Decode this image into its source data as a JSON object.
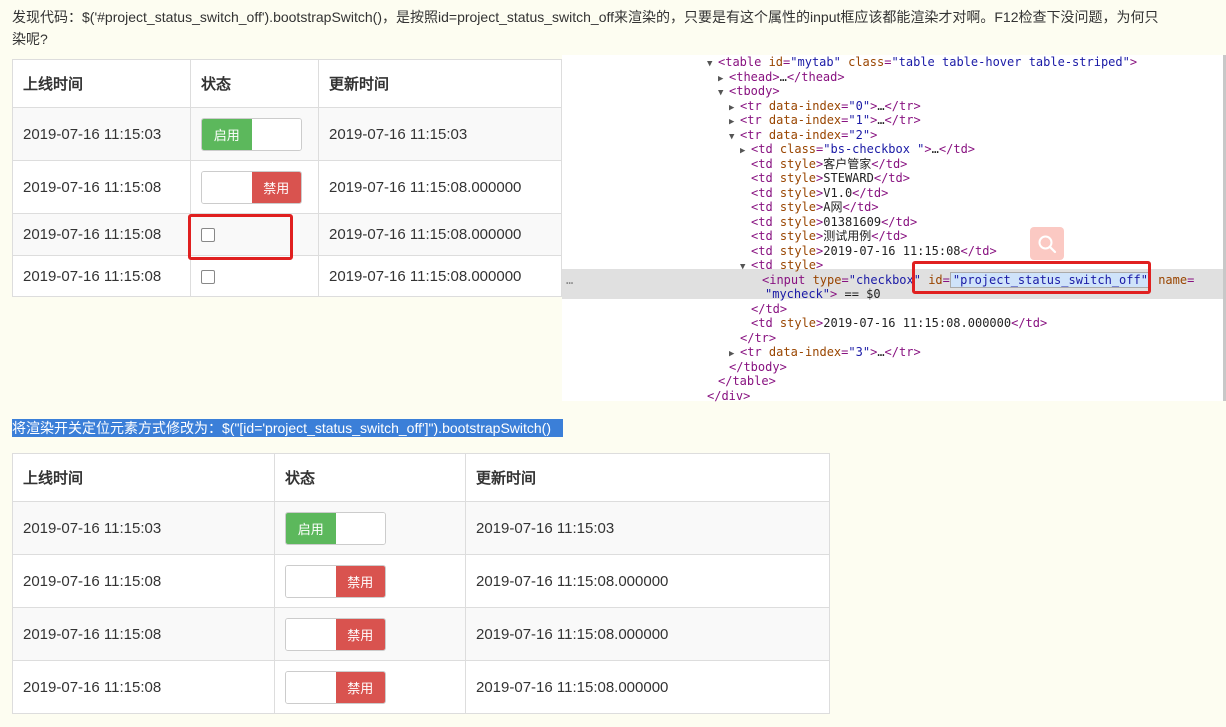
{
  "intro": {
    "line1": "发现代码：$('#project_status_switch_off').bootstrapSwitch()，是按照id=project_status_switch_off来渲染的，只要是有这个属性的input框应该都能渲染才对啊。F12检查下没问题，为何只",
    "line2": "染呢?"
  },
  "table1": {
    "headers": [
      "上线时间",
      "状态",
      "更新时间"
    ],
    "rows": [
      {
        "online": "2019-07-16 11:15:03",
        "state": "switch-on",
        "on_label": "启用",
        "updated": "2019-07-16 11:15:03"
      },
      {
        "online": "2019-07-16 11:15:08",
        "state": "switch-off",
        "off_label": "禁用",
        "updated": "2019-07-16 11:15:08.000000"
      },
      {
        "online": "2019-07-16 11:15:08",
        "state": "checkbox",
        "updated": "2019-07-16 11:15:08.000000"
      },
      {
        "online": "2019-07-16 11:15:08",
        "state": "checkbox",
        "updated": "2019-07-16 11:15:08.000000"
      }
    ]
  },
  "devtools": {
    "lines": [
      {
        "t": "▼",
        "indent": 0,
        "parts": [
          [
            "tag",
            "<table "
          ],
          [
            "attr",
            "id"
          ],
          [
            "tag",
            "="
          ],
          [
            "val",
            "\"mytab\""
          ],
          [
            "tag",
            " "
          ],
          [
            "attr",
            "class"
          ],
          [
            "tag",
            "="
          ],
          [
            "val",
            "\"table table-hover table-striped\""
          ],
          [
            "tag",
            ">"
          ]
        ]
      },
      {
        "t": "▶",
        "indent": 1,
        "parts": [
          [
            "tag",
            "<thead>"
          ],
          [
            "txt",
            "…"
          ],
          [
            "tag",
            "</thead>"
          ]
        ]
      },
      {
        "t": "▼",
        "indent": 1,
        "parts": [
          [
            "tag",
            "<tbody>"
          ]
        ]
      },
      {
        "t": "▶",
        "indent": 2,
        "parts": [
          [
            "tag",
            "<tr "
          ],
          [
            "attr",
            "data-index"
          ],
          [
            "tag",
            "="
          ],
          [
            "val",
            "\"0\""
          ],
          [
            "tag",
            ">"
          ],
          [
            "txt",
            "…"
          ],
          [
            "tag",
            "</tr>"
          ]
        ]
      },
      {
        "t": "▶",
        "indent": 2,
        "parts": [
          [
            "tag",
            "<tr "
          ],
          [
            "attr",
            "data-index"
          ],
          [
            "tag",
            "="
          ],
          [
            "val",
            "\"1\""
          ],
          [
            "tag",
            ">"
          ],
          [
            "txt",
            "…"
          ],
          [
            "tag",
            "</tr>"
          ]
        ]
      },
      {
        "t": "▼",
        "indent": 2,
        "parts": [
          [
            "tag",
            "<tr "
          ],
          [
            "attr",
            "data-index"
          ],
          [
            "tag",
            "="
          ],
          [
            "val",
            "\"2\""
          ],
          [
            "tag",
            ">"
          ]
        ]
      },
      {
        "t": "▶",
        "indent": 3,
        "parts": [
          [
            "tag",
            "<td "
          ],
          [
            "attr",
            "class"
          ],
          [
            "tag",
            "="
          ],
          [
            "val",
            "\"bs-checkbox \""
          ],
          [
            "tag",
            ">"
          ],
          [
            "txt",
            "…"
          ],
          [
            "tag",
            "</td>"
          ]
        ]
      },
      {
        "t": "",
        "indent": 3,
        "parts": [
          [
            "tag",
            "<td "
          ],
          [
            "attr",
            "style"
          ],
          [
            "tag",
            ">"
          ],
          [
            "txt",
            "客户管家"
          ],
          [
            "tag",
            "</td>"
          ]
        ]
      },
      {
        "t": "",
        "indent": 3,
        "parts": [
          [
            "tag",
            "<td "
          ],
          [
            "attr",
            "style"
          ],
          [
            "tag",
            ">"
          ],
          [
            "txt",
            "STEWARD"
          ],
          [
            "tag",
            "</td>"
          ]
        ]
      },
      {
        "t": "",
        "indent": 3,
        "parts": [
          [
            "tag",
            "<td "
          ],
          [
            "attr",
            "style"
          ],
          [
            "tag",
            ">"
          ],
          [
            "txt",
            "V1.0"
          ],
          [
            "tag",
            "</td>"
          ]
        ]
      },
      {
        "t": "",
        "indent": 3,
        "parts": [
          [
            "tag",
            "<td "
          ],
          [
            "attr",
            "style"
          ],
          [
            "tag",
            ">"
          ],
          [
            "txt",
            "A网"
          ],
          [
            "tag",
            "</td>"
          ]
        ]
      },
      {
        "t": "",
        "indent": 3,
        "parts": [
          [
            "tag",
            "<td "
          ],
          [
            "attr",
            "style"
          ],
          [
            "tag",
            ">"
          ],
          [
            "txt",
            "01381609"
          ],
          [
            "tag",
            "</td>"
          ]
        ]
      },
      {
        "t": "",
        "indent": 3,
        "parts": [
          [
            "tag",
            "<td "
          ],
          [
            "attr",
            "style"
          ],
          [
            "tag",
            ">"
          ],
          [
            "txt",
            "测试用例"
          ],
          [
            "tag",
            "</td>"
          ]
        ]
      },
      {
        "t": "",
        "indent": 3,
        "parts": [
          [
            "tag",
            "<td "
          ],
          [
            "attr",
            "style"
          ],
          [
            "tag",
            ">"
          ],
          [
            "txt",
            "2019-07-16 11:15:08"
          ],
          [
            "tag",
            "</td>"
          ]
        ]
      },
      {
        "t": "▼",
        "indent": 3,
        "parts": [
          [
            "tag",
            "<td "
          ],
          [
            "attr",
            "style"
          ],
          [
            "tag",
            ">"
          ]
        ]
      },
      {
        "t": "",
        "indent": 4,
        "parts": [
          [
            "tag",
            "<input "
          ],
          [
            "attr",
            "type"
          ],
          [
            "tag",
            "="
          ],
          [
            "val",
            "\"checkbox\""
          ],
          [
            "tag",
            " "
          ],
          [
            "sel",
            "id=\"project_status_switch_off\""
          ],
          [
            "tag",
            " "
          ],
          [
            "attr",
            "name"
          ],
          [
            "tag",
            "="
          ]
        ]
      },
      {
        "t": "",
        "indent": 4,
        "parts": [
          [
            "val",
            "\"mycheck\""
          ],
          [
            "tag",
            "> "
          ],
          [
            "txt",
            "== $0"
          ]
        ]
      },
      {
        "t": "",
        "indent": 3,
        "parts": [
          [
            "tag",
            "</td>"
          ]
        ]
      },
      {
        "t": "",
        "indent": 3,
        "parts": [
          [
            "tag",
            "<td "
          ],
          [
            "attr",
            "style"
          ],
          [
            "tag",
            ">"
          ],
          [
            "txt",
            "2019-07-16 11:15:08.000000"
          ],
          [
            "tag",
            "</td>"
          ]
        ]
      },
      {
        "t": "",
        "indent": 2,
        "parts": [
          [
            "tag",
            "</tr>"
          ]
        ]
      },
      {
        "t": "▶",
        "indent": 2,
        "parts": [
          [
            "tag",
            "<tr "
          ],
          [
            "attr",
            "data-index"
          ],
          [
            "tag",
            "="
          ],
          [
            "val",
            "\"3\""
          ],
          [
            "tag",
            ">"
          ],
          [
            "txt",
            "…"
          ],
          [
            "tag",
            "</tr>"
          ]
        ]
      },
      {
        "t": "",
        "indent": 1,
        "parts": [
          [
            "tag",
            "</tbody>"
          ]
        ]
      },
      {
        "t": "",
        "indent": 0,
        "parts": [
          [
            "tag",
            "</table>"
          ]
        ]
      },
      {
        "t": "",
        "indent": -1,
        "parts": [
          [
            "tag",
            "</div>"
          ]
        ]
      }
    ],
    "ellipsis": "…"
  },
  "mid_text": "将渲染开关定位元素方式修改为：$(\"[id='project_status_switch_off']\").bootstrapSwitch()",
  "table2": {
    "headers": [
      "上线时间",
      "状态",
      "更新时间"
    ],
    "rows": [
      {
        "online": "2019-07-16 11:15:03",
        "state": "switch-on",
        "on_label": "启用",
        "updated": "2019-07-16 11:15:03"
      },
      {
        "online": "2019-07-16 11:15:08",
        "state": "switch-off",
        "off_label": "禁用",
        "updated": "2019-07-16 11:15:08.000000"
      },
      {
        "online": "2019-07-16 11:15:08",
        "state": "switch-off",
        "off_label": "禁用",
        "updated": "2019-07-16 11:15:08.000000"
      },
      {
        "online": "2019-07-16 11:15:08",
        "state": "switch-off",
        "off_label": "禁用",
        "updated": "2019-07-16 11:15:08.000000"
      }
    ]
  },
  "colors": {
    "switch_on": "#5cb85c",
    "switch_off": "#d9534f",
    "highlight": "#e02020"
  }
}
